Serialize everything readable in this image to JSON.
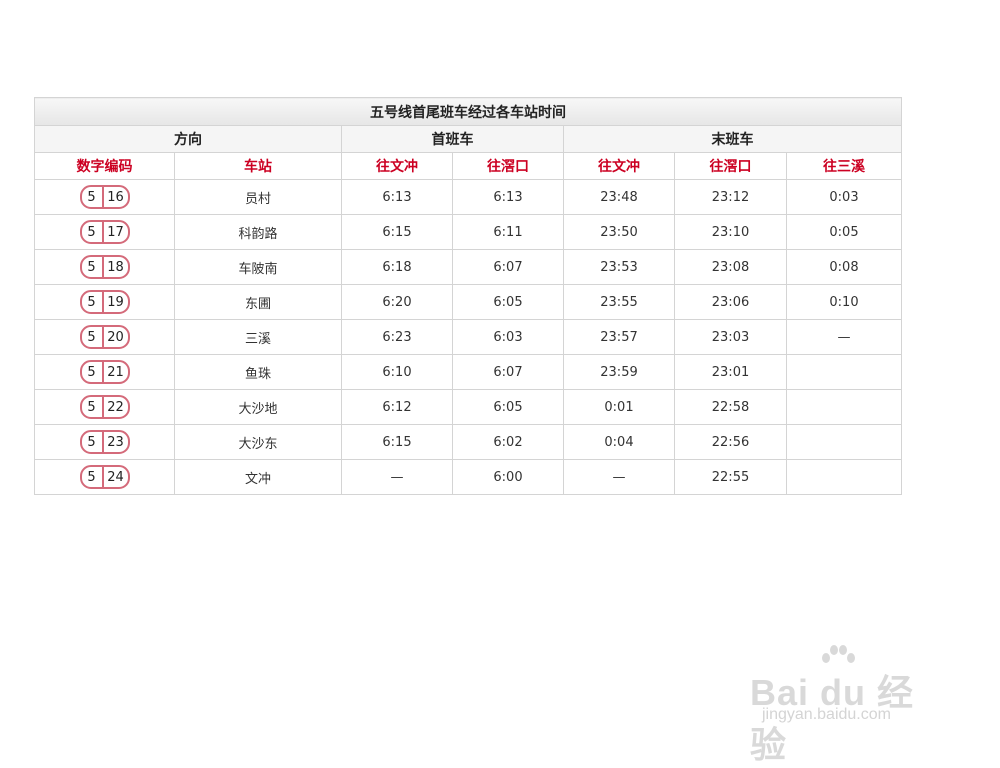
{
  "table": {
    "title": "五号线首尾班车经过各车站时间",
    "groups": {
      "direction": "方向",
      "first": "首班车",
      "last": "末班车"
    },
    "subheaders": {
      "code": "数字编码",
      "station": "车站",
      "first_wenchong": "往文冲",
      "first_jiaokou": "往滘口",
      "last_wenchong": "往文冲",
      "last_jiaokou": "往滘口",
      "last_sanxi": "往三溪"
    },
    "rows": [
      {
        "line": "5",
        "num": "16",
        "station": "员村",
        "first_wenchong": "6:13",
        "first_jiaokou": "6:13",
        "last_wenchong": "23:48",
        "last_jiaokou": "23:12",
        "last_sanxi": "0:03"
      },
      {
        "line": "5",
        "num": "17",
        "station": "科韵路",
        "first_wenchong": "6:15",
        "first_jiaokou": "6:11",
        "last_wenchong": "23:50",
        "last_jiaokou": "23:10",
        "last_sanxi": "0:05"
      },
      {
        "line": "5",
        "num": "18",
        "station": "车陂南",
        "first_wenchong": "6:18",
        "first_jiaokou": "6:07",
        "last_wenchong": "23:53",
        "last_jiaokou": "23:08",
        "last_sanxi": "0:08"
      },
      {
        "line": "5",
        "num": "19",
        "station": "东圃",
        "first_wenchong": "6:20",
        "first_jiaokou": "6:05",
        "last_wenchong": "23:55",
        "last_jiaokou": "23:06",
        "last_sanxi": "0:10"
      },
      {
        "line": "5",
        "num": "20",
        "station": "三溪",
        "first_wenchong": "6:23",
        "first_jiaokou": "6:03",
        "last_wenchong": "23:57",
        "last_jiaokou": "23:03",
        "last_sanxi": "—"
      },
      {
        "line": "5",
        "num": "21",
        "station": "鱼珠",
        "first_wenchong": "6:10",
        "first_jiaokou": "6:07",
        "last_wenchong": "23:59",
        "last_jiaokou": "23:01",
        "last_sanxi": ""
      },
      {
        "line": "5",
        "num": "22",
        "station": "大沙地",
        "first_wenchong": "6:12",
        "first_jiaokou": "6:05",
        "last_wenchong": "0:01",
        "last_jiaokou": "22:58",
        "last_sanxi": ""
      },
      {
        "line": "5",
        "num": "23",
        "station": "大沙东",
        "first_wenchong": "6:15",
        "first_jiaokou": "6:02",
        "last_wenchong": "0:04",
        "last_jiaokou": "22:56",
        "last_sanxi": ""
      },
      {
        "line": "5",
        "num": "24",
        "station": "文冲",
        "first_wenchong": "—",
        "first_jiaokou": "6:00",
        "last_wenchong": "—",
        "last_jiaokou": "22:55",
        "last_sanxi": ""
      }
    ]
  },
  "watermark": {
    "brand": "Bai du 经验",
    "url": "jingyan.baidu.com",
    "icon": "paw-icon"
  },
  "colors": {
    "header_red": "#cc0022",
    "badge_border": "#d46a7a"
  }
}
